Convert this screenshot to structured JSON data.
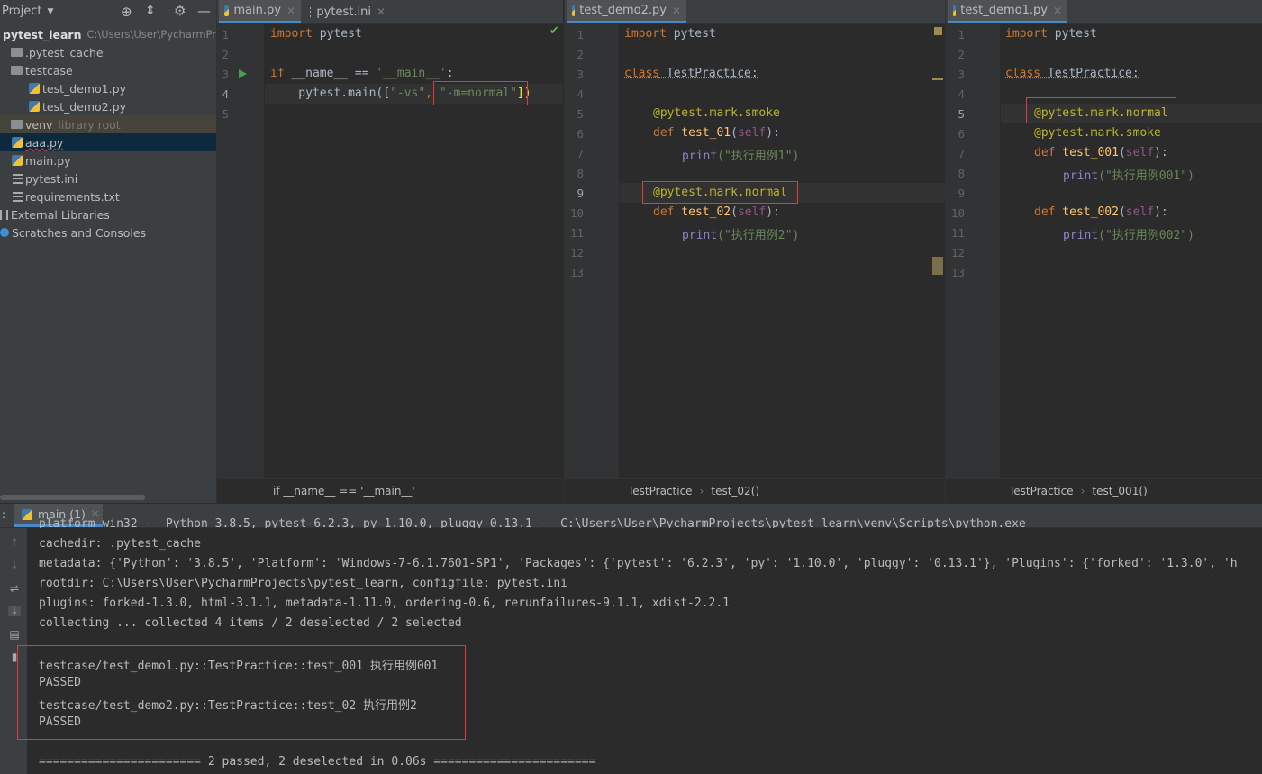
{
  "project": {
    "title": "Project",
    "root_name": "pytest_learn",
    "root_path": "C:\\Users\\User\\PycharmPr",
    "items": [
      {
        "label": ".pytest_cache"
      },
      {
        "label": "testcase"
      },
      {
        "label": "test_demo1.py"
      },
      {
        "label": "test_demo2.py"
      },
      {
        "label": "venv",
        "extra": "library root"
      },
      {
        "label": "aaa.py"
      },
      {
        "label": "main.py"
      },
      {
        "label": "pytest.ini"
      },
      {
        "label": "requirements.txt"
      },
      {
        "label": "External Libraries"
      },
      {
        "label": "Scratches and Consoles"
      }
    ]
  },
  "pane1": {
    "tabs": [
      "main.py",
      "pytest.ini"
    ],
    "line_numbers": [
      "1",
      "2",
      "3",
      "4",
      "5"
    ],
    "breadcrumb": "if __name__ == '__main__'"
  },
  "pane2": {
    "tab": "test_demo2.py",
    "line_numbers": [
      "1",
      "2",
      "3",
      "4",
      "5",
      "6",
      "7",
      "8",
      "9",
      "10",
      "11",
      "12",
      "13"
    ],
    "breadcrumb_class": "TestPractice",
    "breadcrumb_fn": "test_02()"
  },
  "pane3": {
    "tab": "test_demo1.py",
    "line_numbers": [
      "1",
      "2",
      "3",
      "4",
      "5",
      "6",
      "7",
      "8",
      "9",
      "10",
      "11",
      "12",
      "13"
    ],
    "breadcrumb_class": "TestPractice",
    "breadcrumb_fn": "test_001()"
  },
  "code": {
    "import": "import",
    "pytest": " pytest",
    "if": "if",
    "name_cmp": " __name__ == ",
    "main_str": "'__main__'",
    "colon": ":",
    "pytest_main": "    pytest.main([",
    "vs": "\"-vs\"",
    "comma": ", ",
    "m_normal": "\"-m=normal\"",
    "close": "])",
    "class": "class",
    "class_name": " TestPractice:",
    "mark_smoke": "@pytest.mark.smoke",
    "mark_normal": "@pytest.mark.normal",
    "def": "def",
    "test_01": " test_01",
    "test_02": " test_02",
    "test_001": " test_001",
    "test_002": " test_002",
    "paren_open": "(",
    "self": "self",
    "paren_close": "):",
    "print": "print",
    "s1": "(\"执行用例1\")",
    "s2": "(\"执行用例2\")",
    "s001": "(\"执行用例001\")",
    "s002": "(\"执行用例002\")"
  },
  "run": {
    "tab": "main (1)",
    "lines": [
      "platform win32 -- Python 3.8.5, pytest-6.2.3, py-1.10.0, pluggy-0.13.1 -- C:\\Users\\User\\PycharmProjects\\pytest_learn\\venv\\Scripts\\python.exe",
      "cachedir: .pytest_cache",
      "metadata: {'Python': '3.8.5', 'Platform': 'Windows-7-6.1.7601-SP1', 'Packages': {'pytest': '6.2.3', 'py': '1.10.0', 'pluggy': '0.13.1'}, 'Plugins': {'forked': '1.3.0', 'h",
      "rootdir: C:\\Users\\User\\PycharmProjects\\pytest_learn, configfile: pytest.ini",
      "plugins: forked-1.3.0, html-3.1.1, metadata-1.11.0, ordering-0.6, rerunfailures-9.1.1, xdist-2.2.1",
      "collecting ... collected 4 items / 2 deselected / 2 selected",
      "",
      "testcase/test_demo1.py::TestPractice::test_001 执行用例001",
      "PASSED",
      "testcase/test_demo2.py::TestPractice::test_02 执行用例2",
      "PASSED",
      "",
      "======================= 2 passed, 2 deselected in 0.06s ======================="
    ]
  }
}
